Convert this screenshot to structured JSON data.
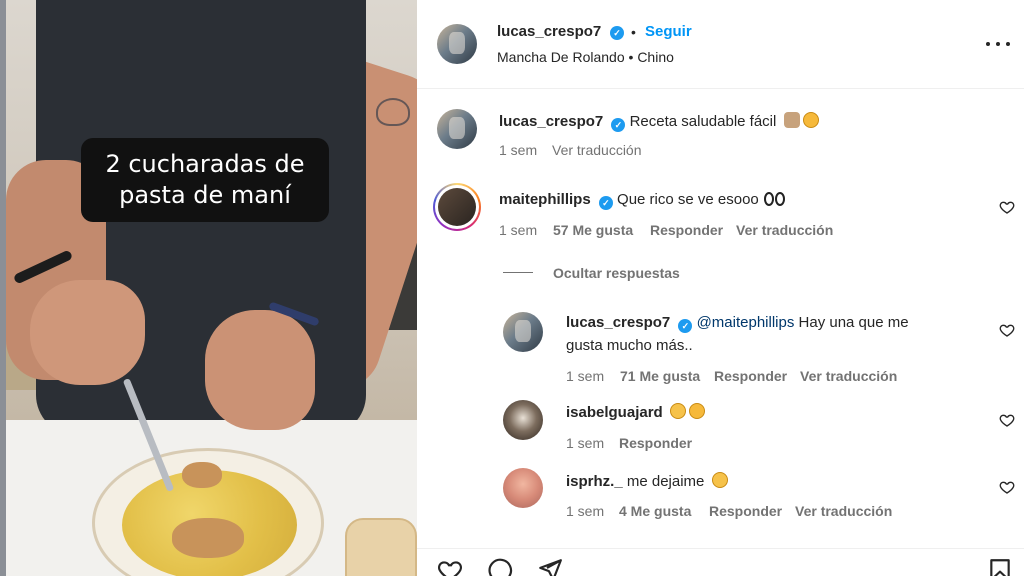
{
  "media": {
    "caption_text": "2 cucharadas de\npasta de maní"
  },
  "header": {
    "username": "lucas_crespo7",
    "dot": "•",
    "follow_label": "Seguir",
    "location": "Mancha De Rolando • Chino"
  },
  "caption": {
    "username": "lucas_crespo7",
    "text": "Receta saludable fácil",
    "emoji_icons": [
      "sign-of-horns-emoji",
      "face-emoji"
    ],
    "time": "1 sem",
    "translate": "Ver traducción"
  },
  "comments": [
    {
      "username": "maitephillips",
      "verified": true,
      "text": "Que rico se ve esooo",
      "emoji_icons": [
        "eyes-emoji"
      ],
      "time": "1 sem",
      "likes": "57 Me gusta",
      "reply": "Responder",
      "translate": "Ver traducción"
    }
  ],
  "hide_replies": "Ocultar respuestas",
  "replies": [
    {
      "username": "lucas_crespo7",
      "verified": true,
      "mention": "@maitephillips",
      "text_line1": "Hay una que me",
      "text_line2": "gusta mucho más..",
      "time": "1 sem",
      "likes": "71 Me gusta",
      "reply": "Responder",
      "translate": "Ver traducción"
    },
    {
      "username": "isabelguajard",
      "emoji_icons": [
        "astonished-face-emoji",
        "grimacing-face-emoji"
      ],
      "time": "1 sem",
      "reply": "Responder"
    },
    {
      "username": "isprhz._",
      "text": "me dejaime",
      "emoji_icons": [
        "surprised-face-emoji"
      ],
      "time": "1 sem",
      "likes": "4 Me gusta",
      "reply": "Responder",
      "translate": "Ver traducción"
    }
  ],
  "actions": [
    "heart-icon",
    "comment-icon",
    "share-icon",
    "bookmark-icon"
  ],
  "colors": {
    "link_blue": "#0095f6",
    "verified_blue": "#1d9bf0",
    "muted_text": "#737373",
    "text": "#262626"
  }
}
